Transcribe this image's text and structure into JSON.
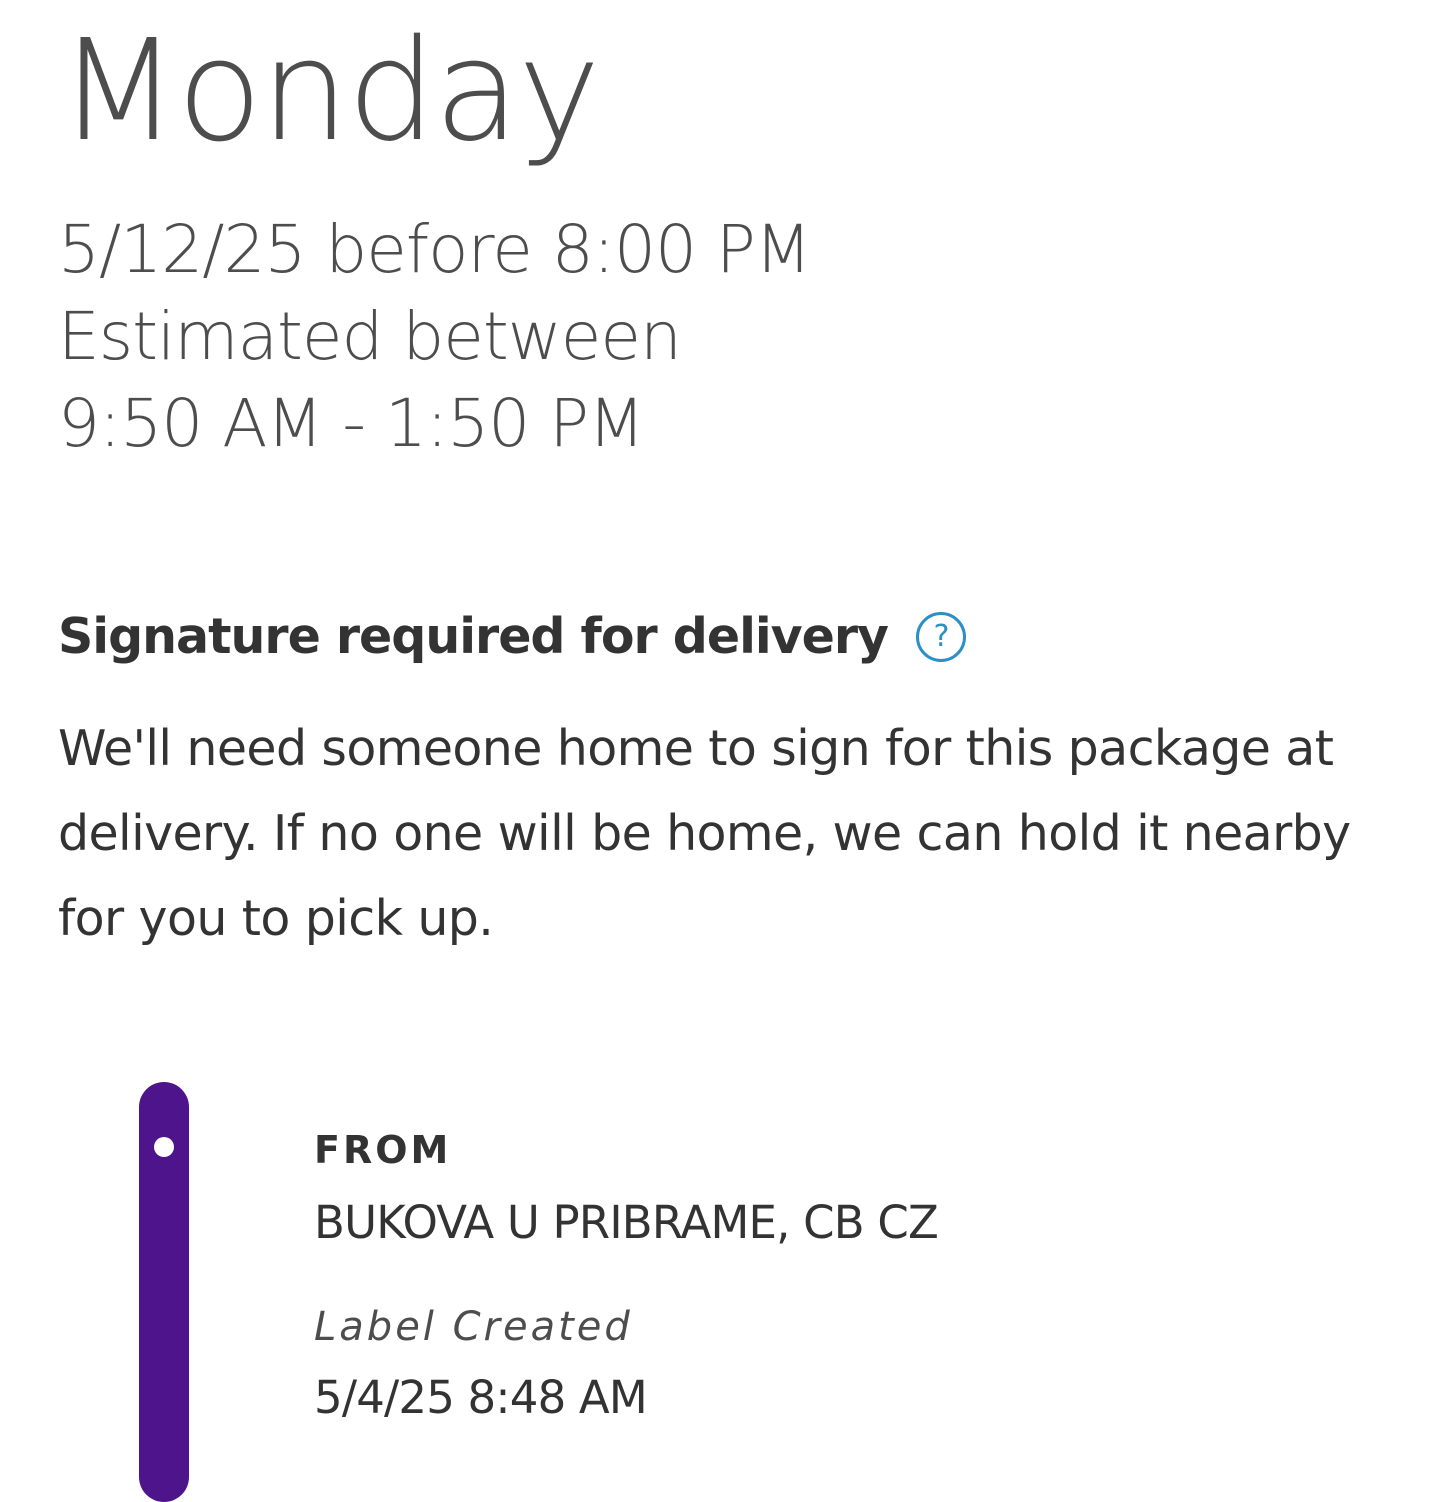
{
  "delivery": {
    "day": "Monday",
    "date_line": "5/12/25 before 8:00 PM",
    "estimate_label": "Estimated between",
    "estimate_window": "9:50 AM - 1:50 PM"
  },
  "signature": {
    "heading": "Signature required for delivery",
    "help_icon": "?",
    "body": "We'll need someone home to sign for this package at delivery. If no one will be home, we can hold it nearby for you to pick up."
  },
  "timeline": {
    "accent_color": "#4d148c",
    "from_label": "FROM",
    "from_location": "BUKOVA U PRIBRAME, CB CZ",
    "event_status": "Label Created",
    "event_time": "5/4/25 8:48 AM"
  },
  "colors": {
    "help_icon": "#2c8fc5",
    "text": "#333333"
  }
}
